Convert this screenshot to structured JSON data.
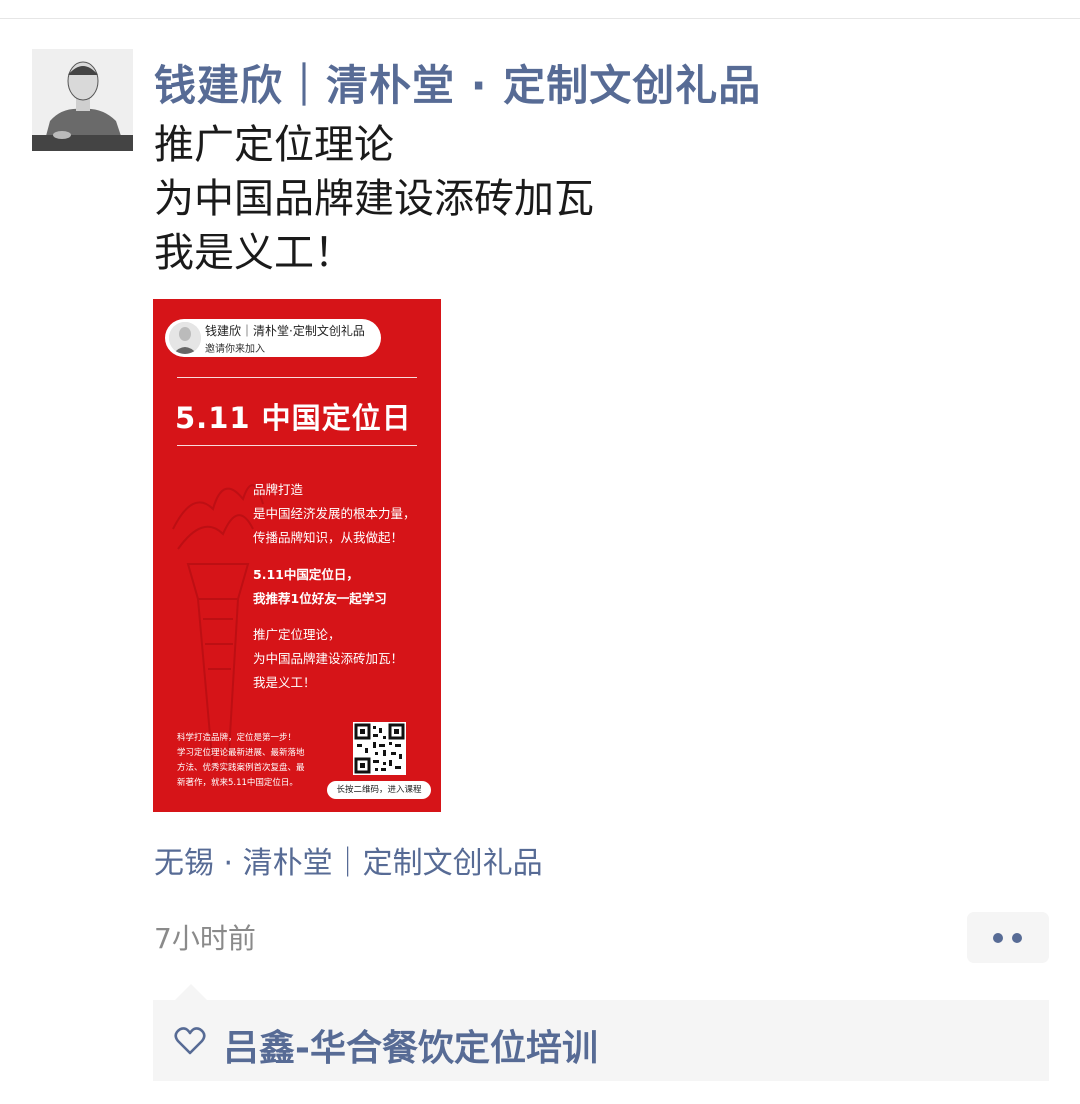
{
  "author": {
    "name": "钱建欣｜清朴堂 · 定制文创礼品"
  },
  "post": {
    "text": "推广定位理论\n为中国品牌建设添砖加瓦\n我是义工！"
  },
  "poster": {
    "pill_name": "钱建欣｜清朴堂·定制文创礼品",
    "pill_invite": "邀请你来加入",
    "title": "5.11 中国定位日",
    "para1": "品牌打造\n是中国经济发展的根本力量，\n传播品牌知识，从我做起！",
    "para2": "5.11中国定位日，\n我推荐1位好友一起学习",
    "para3": "推广定位理论，\n为中国品牌建设添砖加瓦！\n我是义工！",
    "small_text": "科学打造品牌，定位是第一步！\n学习定位理论最新进展、最新落地\n方法、优秀实践案例首次复盘、最\n新著作，就来5.11中国定位日。",
    "qr_button": "长按二维码，进入课程",
    "bg_color": "#d61418"
  },
  "location": "无锡 · 清朴堂｜定制文创礼品",
  "time": "7小时前",
  "more_icon": "more-dots-icon",
  "likes": {
    "icon": "heart-outline-icon",
    "names": "吕鑫-华合餐饮定位培训"
  },
  "colors": {
    "link": "#576b95",
    "text": "#1a1a1a",
    "muted": "#8a8a8a",
    "panel": "#f5f5f5"
  }
}
